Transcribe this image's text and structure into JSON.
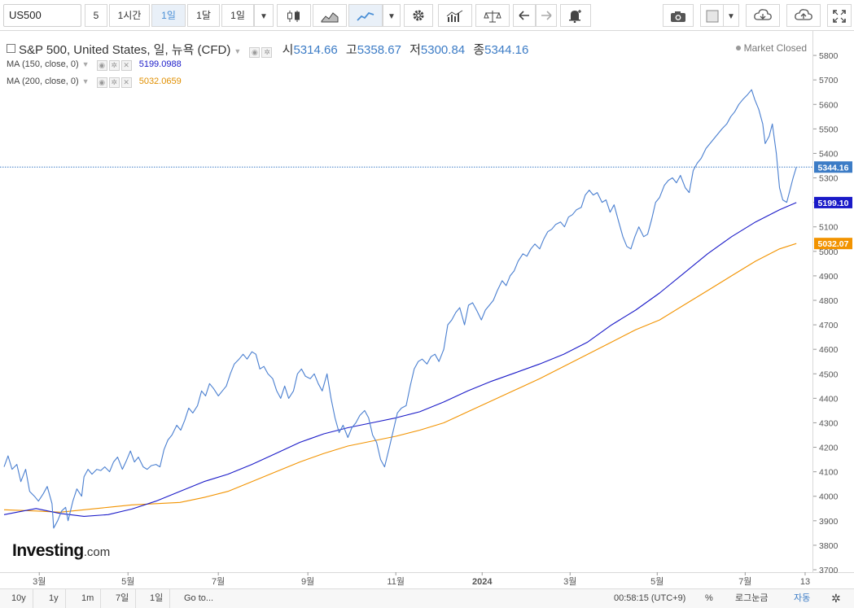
{
  "toolbar": {
    "symbol": "US500",
    "intervals": [
      "5",
      "1시간",
      "1일",
      "1달",
      "1일"
    ],
    "active_interval": "1일",
    "colors": {
      "active_bg": "#e9f0f8",
      "active_text": "#4a8fd6"
    },
    "icons": [
      "candlestick-icon",
      "mountain-chart-icon",
      "line-chart-icon",
      "gear-icon",
      "indicators-icon",
      "compare-icon",
      "undo-icon",
      "redo-icon",
      "alert-icon",
      "camera-icon",
      "color-box-icon",
      "cloud-download-icon",
      "cloud-upload-icon",
      "fullscreen-icon"
    ]
  },
  "legend": {
    "title": "S&P 500, United States, 일, 뉴욕 (CFD)",
    "open_label": "시",
    "open": "5314.66",
    "high_label": "고",
    "high": "5358.67",
    "low_label": "저",
    "low": "5300.84",
    "close_label": "종",
    "close": "5344.16",
    "ma1_label": "MA (150, close, 0)",
    "ma1_value": "5199.0988",
    "ma2_label": "MA (200, close, 0)",
    "ma2_value": "5032.0659",
    "market_status": "Market Closed"
  },
  "logo": {
    "main": "Investing",
    "suffix": ".com"
  },
  "bottom": {
    "ranges": [
      "10y",
      "1y",
      "1m",
      "7일",
      "1일"
    ],
    "goto": "Go to...",
    "clock": "00:58:15 (UTC+9)",
    "percent": "%",
    "log": "로그눈금",
    "auto": "자동",
    "icons": [
      "gear-icon"
    ]
  },
  "chart_data": {
    "type": "line",
    "y_range": [
      3700,
      5900
    ],
    "y_ticks": [
      5800,
      5700,
      5600,
      5500,
      5400,
      5300,
      5200,
      5100,
      5000,
      4900,
      4800,
      4700,
      4600,
      4500,
      4400,
      4300,
      4200,
      4100,
      4000,
      3900,
      3800,
      3700
    ],
    "x_tick_labels": [
      {
        "label": "3월",
        "t": 0.044
      },
      {
        "label": "5월",
        "t": 0.155
      },
      {
        "label": "7월",
        "t": 0.268
      },
      {
        "label": "9월",
        "t": 0.38
      },
      {
        "label": "11월",
        "t": 0.49
      },
      {
        "label": "2024",
        "t": 0.598
      },
      {
        "label": "3월",
        "t": 0.708
      },
      {
        "label": "5월",
        "t": 0.817
      },
      {
        "label": "7월",
        "t": 0.927
      },
      {
        "label": "13",
        "t": 1.002
      }
    ],
    "last_price_line": 5344.16,
    "price_labels": [
      {
        "value": 5344.16,
        "text": "5344.16",
        "color": "#3c7cc6"
      },
      {
        "value": 5199.1,
        "text": "5199.10",
        "color": "#1a1ac8"
      },
      {
        "value": 5032.07,
        "text": "5032.07",
        "color": "#f29300"
      }
    ],
    "series": [
      {
        "name": "S&P 500",
        "color": "#4a7fd0",
        "points": [
          [
            0,
            4120
          ],
          [
            0.005,
            4165
          ],
          [
            0.01,
            4110
          ],
          [
            0.016,
            4130
          ],
          [
            0.021,
            4060
          ],
          [
            0.027,
            4110
          ],
          [
            0.032,
            4020
          ],
          [
            0.038,
            4000
          ],
          [
            0.043,
            3980
          ],
          [
            0.049,
            4010
          ],
          [
            0.054,
            4040
          ],
          [
            0.06,
            3970
          ],
          [
            0.062,
            3870
          ],
          [
            0.067,
            3900
          ],
          [
            0.072,
            3940
          ],
          [
            0.077,
            3955
          ],
          [
            0.08,
            3900
          ],
          [
            0.086,
            3980
          ],
          [
            0.091,
            4030
          ],
          [
            0.097,
            4000
          ],
          [
            0.1,
            4080
          ],
          [
            0.105,
            4110
          ],
          [
            0.11,
            4090
          ],
          [
            0.116,
            4110
          ],
          [
            0.121,
            4105
          ],
          [
            0.126,
            4120
          ],
          [
            0.132,
            4100
          ],
          [
            0.137,
            4140
          ],
          [
            0.142,
            4160
          ],
          [
            0.148,
            4110
          ],
          [
            0.153,
            4145
          ],
          [
            0.158,
            4185
          ],
          [
            0.163,
            4140
          ],
          [
            0.168,
            4160
          ],
          [
            0.174,
            4120
          ],
          [
            0.179,
            4110
          ],
          [
            0.184,
            4125
          ],
          [
            0.19,
            4130
          ],
          [
            0.195,
            4120
          ],
          [
            0.2,
            4190
          ],
          [
            0.205,
            4230
          ],
          [
            0.21,
            4250
          ],
          [
            0.216,
            4290
          ],
          [
            0.221,
            4270
          ],
          [
            0.226,
            4310
          ],
          [
            0.231,
            4360
          ],
          [
            0.236,
            4340
          ],
          [
            0.242,
            4370
          ],
          [
            0.247,
            4430
          ],
          [
            0.252,
            4410
          ],
          [
            0.257,
            4460
          ],
          [
            0.262,
            4440
          ],
          [
            0.268,
            4410
          ],
          [
            0.273,
            4430
          ],
          [
            0.278,
            4450
          ],
          [
            0.283,
            4500
          ],
          [
            0.288,
            4540
          ],
          [
            0.294,
            4560
          ],
          [
            0.299,
            4580
          ],
          [
            0.304,
            4560
          ],
          [
            0.31,
            4590
          ],
          [
            0.315,
            4580
          ],
          [
            0.32,
            4520
          ],
          [
            0.325,
            4530
          ],
          [
            0.33,
            4500
          ],
          [
            0.336,
            4480
          ],
          [
            0.341,
            4430
          ],
          [
            0.346,
            4400
          ],
          [
            0.351,
            4450
          ],
          [
            0.356,
            4400
          ],
          [
            0.362,
            4430
          ],
          [
            0.367,
            4500
          ],
          [
            0.372,
            4520
          ],
          [
            0.377,
            4490
          ],
          [
            0.383,
            4480
          ],
          [
            0.388,
            4500
          ],
          [
            0.393,
            4460
          ],
          [
            0.398,
            4430
          ],
          [
            0.404,
            4500
          ],
          [
            0.409,
            4400
          ],
          [
            0.414,
            4320
          ],
          [
            0.419,
            4260
          ],
          [
            0.424,
            4290
          ],
          [
            0.43,
            4240
          ],
          [
            0.435,
            4280
          ],
          [
            0.44,
            4300
          ],
          [
            0.445,
            4330
          ],
          [
            0.451,
            4350
          ],
          [
            0.456,
            4320
          ],
          [
            0.461,
            4250
          ],
          [
            0.466,
            4220
          ],
          [
            0.471,
            4150
          ],
          [
            0.476,
            4120
          ],
          [
            0.482,
            4200
          ],
          [
            0.487,
            4270
          ],
          [
            0.492,
            4340
          ],
          [
            0.497,
            4360
          ],
          [
            0.503,
            4370
          ],
          [
            0.508,
            4450
          ],
          [
            0.513,
            4520
          ],
          [
            0.518,
            4550
          ],
          [
            0.523,
            4560
          ],
          [
            0.529,
            4540
          ],
          [
            0.534,
            4570
          ],
          [
            0.539,
            4580
          ],
          [
            0.544,
            4550
          ],
          [
            0.55,
            4600
          ],
          [
            0.555,
            4700
          ],
          [
            0.56,
            4720
          ],
          [
            0.565,
            4750
          ],
          [
            0.57,
            4770
          ],
          [
            0.576,
            4700
          ],
          [
            0.581,
            4780
          ],
          [
            0.586,
            4790
          ],
          [
            0.591,
            4760
          ],
          [
            0.597,
            4720
          ],
          [
            0.602,
            4760
          ],
          [
            0.607,
            4780
          ],
          [
            0.612,
            4800
          ],
          [
            0.617,
            4840
          ],
          [
            0.623,
            4880
          ],
          [
            0.628,
            4860
          ],
          [
            0.633,
            4900
          ],
          [
            0.638,
            4920
          ],
          [
            0.643,
            4960
          ],
          [
            0.649,
            4990
          ],
          [
            0.654,
            4980
          ],
          [
            0.659,
            5010
          ],
          [
            0.664,
            5030
          ],
          [
            0.67,
            5010
          ],
          [
            0.675,
            5050
          ],
          [
            0.68,
            5080
          ],
          [
            0.685,
            5090
          ],
          [
            0.69,
            5110
          ],
          [
            0.696,
            5120
          ],
          [
            0.701,
            5100
          ],
          [
            0.706,
            5140
          ],
          [
            0.711,
            5150
          ],
          [
            0.716,
            5170
          ],
          [
            0.722,
            5180
          ],
          [
            0.727,
            5230
          ],
          [
            0.732,
            5250
          ],
          [
            0.737,
            5230
          ],
          [
            0.742,
            5240
          ],
          [
            0.748,
            5200
          ],
          [
            0.753,
            5210
          ],
          [
            0.758,
            5160
          ],
          [
            0.763,
            5190
          ],
          [
            0.768,
            5130
          ],
          [
            0.774,
            5060
          ],
          [
            0.779,
            5020
          ],
          [
            0.784,
            5010
          ],
          [
            0.789,
            5060
          ],
          [
            0.794,
            5100
          ],
          [
            0.8,
            5060
          ],
          [
            0.805,
            5070
          ],
          [
            0.81,
            5130
          ],
          [
            0.815,
            5200
          ],
          [
            0.82,
            5220
          ],
          [
            0.826,
            5270
          ],
          [
            0.831,
            5290
          ],
          [
            0.836,
            5300
          ],
          [
            0.841,
            5280
          ],
          [
            0.846,
            5310
          ],
          [
            0.852,
            5260
          ],
          [
            0.857,
            5240
          ],
          [
            0.862,
            5330
          ],
          [
            0.867,
            5360
          ],
          [
            0.872,
            5380
          ],
          [
            0.878,
            5420
          ],
          [
            0.883,
            5440
          ],
          [
            0.888,
            5460
          ],
          [
            0.893,
            5480
          ],
          [
            0.898,
            5500
          ],
          [
            0.904,
            5520
          ],
          [
            0.909,
            5550
          ],
          [
            0.914,
            5570
          ],
          [
            0.919,
            5600
          ],
          [
            0.924,
            5620
          ],
          [
            0.93,
            5640
          ],
          [
            0.935,
            5660
          ],
          [
            0.939,
            5620
          ],
          [
            0.944,
            5580
          ],
          [
            0.949,
            5520
          ],
          [
            0.952,
            5440
          ],
          [
            0.957,
            5470
          ],
          [
            0.961,
            5520
          ],
          [
            0.966,
            5400
          ],
          [
            0.97,
            5260
          ],
          [
            0.974,
            5210
          ],
          [
            0.979,
            5200
          ],
          [
            0.983,
            5250
          ],
          [
            0.987,
            5300
          ],
          [
            0.991,
            5344.16
          ]
        ]
      },
      {
        "name": "MA (150, close, 0)",
        "color": "#1a1ac8",
        "points": [
          [
            0,
            3925
          ],
          [
            0.04,
            3950
          ],
          [
            0.07,
            3930
          ],
          [
            0.1,
            3918
          ],
          [
            0.13,
            3925
          ],
          [
            0.16,
            3948
          ],
          [
            0.19,
            3980
          ],
          [
            0.22,
            4020
          ],
          [
            0.25,
            4060
          ],
          [
            0.28,
            4090
          ],
          [
            0.31,
            4130
          ],
          [
            0.34,
            4175
          ],
          [
            0.37,
            4220
          ],
          [
            0.4,
            4255
          ],
          [
            0.43,
            4280
          ],
          [
            0.46,
            4300
          ],
          [
            0.49,
            4320
          ],
          [
            0.52,
            4345
          ],
          [
            0.55,
            4385
          ],
          [
            0.58,
            4430
          ],
          [
            0.61,
            4470
          ],
          [
            0.64,
            4505
          ],
          [
            0.67,
            4540
          ],
          [
            0.7,
            4580
          ],
          [
            0.73,
            4630
          ],
          [
            0.76,
            4700
          ],
          [
            0.79,
            4760
          ],
          [
            0.82,
            4830
          ],
          [
            0.85,
            4910
          ],
          [
            0.88,
            4990
          ],
          [
            0.91,
            5060
          ],
          [
            0.94,
            5120
          ],
          [
            0.97,
            5170
          ],
          [
            0.991,
            5199.0988
          ]
        ]
      },
      {
        "name": "MA (200, close, 0)",
        "color": "#f29300",
        "points": [
          [
            0,
            3945
          ],
          [
            0.04,
            3940
          ],
          [
            0.07,
            3935
          ],
          [
            0.1,
            3945
          ],
          [
            0.13,
            3955
          ],
          [
            0.16,
            3965
          ],
          [
            0.19,
            3970
          ],
          [
            0.22,
            3975
          ],
          [
            0.25,
            3995
          ],
          [
            0.28,
            4020
          ],
          [
            0.31,
            4060
          ],
          [
            0.34,
            4100
          ],
          [
            0.37,
            4140
          ],
          [
            0.4,
            4175
          ],
          [
            0.43,
            4205
          ],
          [
            0.46,
            4225
          ],
          [
            0.49,
            4245
          ],
          [
            0.52,
            4270
          ],
          [
            0.55,
            4300
          ],
          [
            0.58,
            4345
          ],
          [
            0.61,
            4390
          ],
          [
            0.64,
            4435
          ],
          [
            0.67,
            4480
          ],
          [
            0.7,
            4530
          ],
          [
            0.73,
            4580
          ],
          [
            0.76,
            4630
          ],
          [
            0.79,
            4680
          ],
          [
            0.82,
            4720
          ],
          [
            0.85,
            4780
          ],
          [
            0.88,
            4840
          ],
          [
            0.91,
            4900
          ],
          [
            0.94,
            4960
          ],
          [
            0.97,
            5010
          ],
          [
            0.991,
            5032.0659
          ]
        ]
      }
    ]
  }
}
